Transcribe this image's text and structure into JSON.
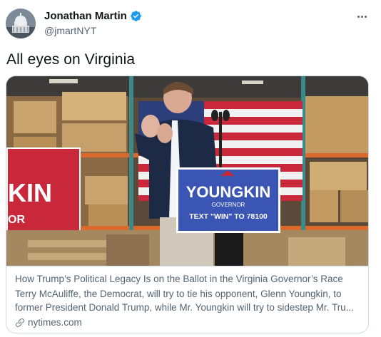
{
  "tweet": {
    "author": {
      "display_name": "Jonathan Martin",
      "handle": "@jmartNYT",
      "verified": true,
      "avatar_icon": "capitol-dome-avatar"
    },
    "more_icon": "more-horizontal-icon",
    "text": "All eyes on Virginia"
  },
  "card": {
    "image": {
      "icon": "campaign-rally-photo",
      "sign_left_text": "KIN",
      "sign_left_sub": "OR",
      "podium_name": "YOUNGKIN",
      "podium_role": "GOVERNOR",
      "podium_cta": "TEXT \"WIN\" TO 78100"
    },
    "title": "How Trump’s Political Legacy Is on the Ballot in the Virginia Governor’s Race",
    "description": "Terry McAuliffe, the Democrat, will try to tie his opponent, Glenn Youngkin, to former President Donald Trump, while Mr. Youngkin will try to sidestep Mr. Tru...",
    "domain": "nytimes.com",
    "domain_icon": "link-icon"
  },
  "colors": {
    "verified_blue": "#1d9bf0",
    "secondary_text": "#536471",
    "card_border": "#cfd9de",
    "podium_blue": "#3a55b4",
    "sign_red": "#c8283a"
  }
}
